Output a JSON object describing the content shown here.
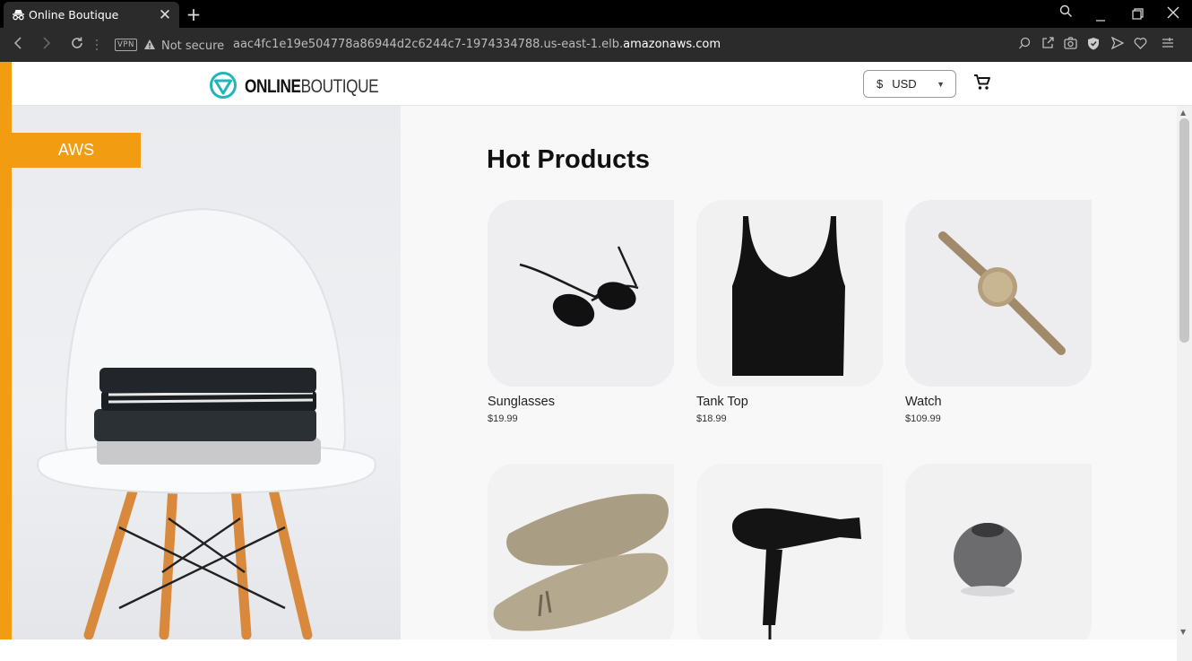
{
  "browser": {
    "tab_title": "Online Boutique",
    "close_glyph": "✕",
    "newtab_glyph": "+",
    "vpn_label": "VPN",
    "security_label": "Not secure",
    "url_prefix": "aac4fc1e19e504778a86944d2c6244c7-1974334788.us-east-1.elb.",
    "url_domain": "amazonaws.com"
  },
  "header": {
    "logo_strong": "ONLINE",
    "logo_thin": "BOUTIQUE",
    "currency_symbol": "$",
    "currency_code": "USD",
    "accent_color": "#1fb5b9"
  },
  "hero": {
    "badge_label": "AWS",
    "badge_color": "#f29c12"
  },
  "main": {
    "section_title": "Hot Products",
    "products": [
      {
        "name": "Sunglasses",
        "price": "$19.99"
      },
      {
        "name": "Tank Top",
        "price": "$18.99"
      },
      {
        "name": "Watch",
        "price": "$109.99"
      },
      {
        "name": "",
        "price": ""
      },
      {
        "name": "",
        "price": ""
      },
      {
        "name": "",
        "price": ""
      }
    ]
  }
}
